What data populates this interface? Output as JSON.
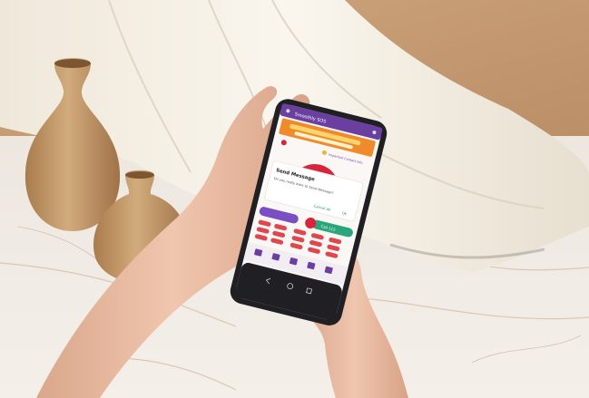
{
  "app": {
    "title": "Smoothly SOS",
    "info_line": "Important Contact Info",
    "accent": "#6a3fa0",
    "banner_color": "#f08a2a"
  },
  "dialog": {
    "title": "Send Message",
    "body": "Do you really want to Send Message?",
    "cancel_label": "Cancel All",
    "ok_label": "Ok"
  },
  "bottom_bar": {
    "call_label": "Call 112",
    "left_pill_color": "#7b4fc4",
    "right_pill_color": "#2aa67a"
  },
  "colors": {
    "wall": "#c7a07a",
    "marble": "#efe9e2",
    "cloth": "#f3ede0",
    "vase": "#c9a06e",
    "skin": "#e6b89f",
    "phone_frame": "#1f1f24",
    "emergency_button": "#d9243a"
  }
}
